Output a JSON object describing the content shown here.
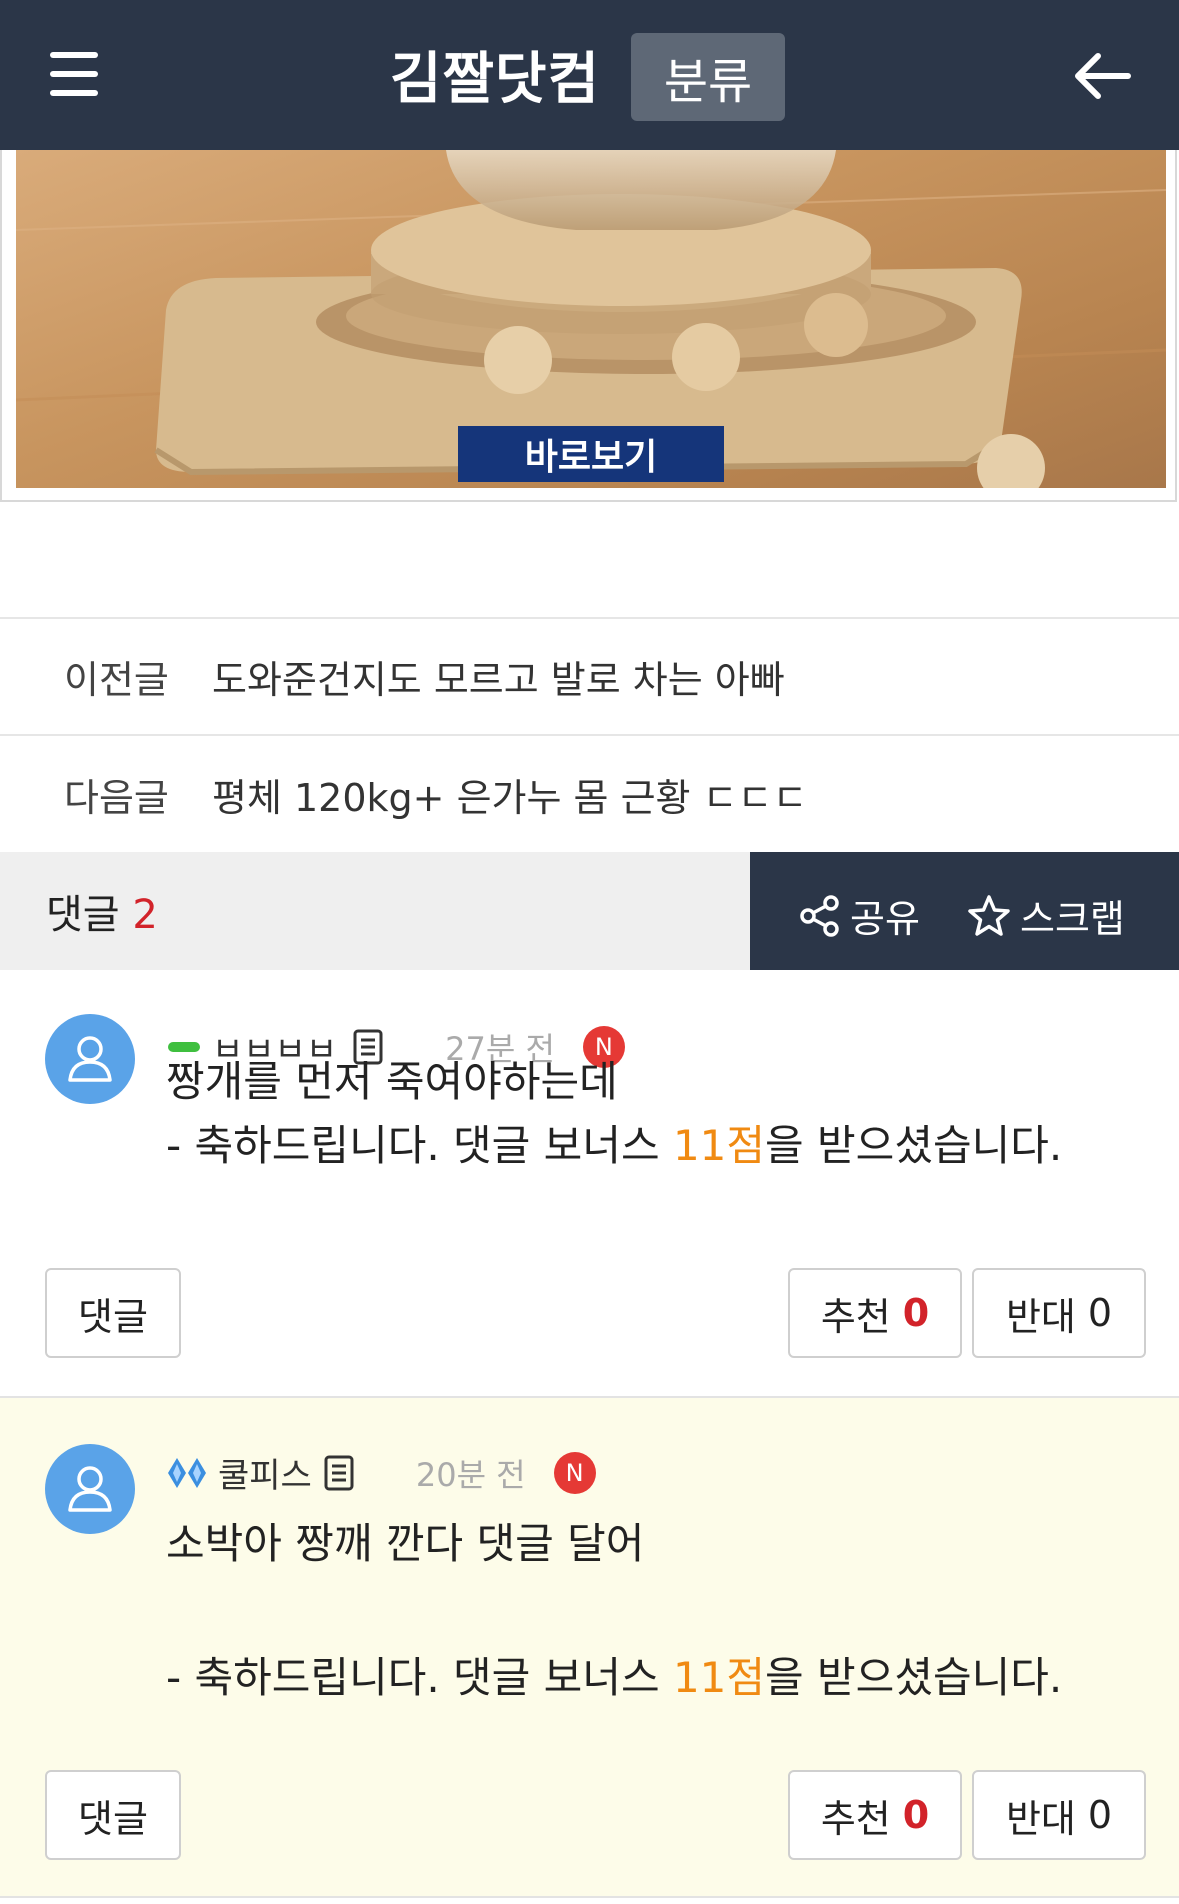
{
  "header": {
    "site_title": "김짤닷컴",
    "category_label": "분류"
  },
  "image": {
    "view_label": "바로보기"
  },
  "nav": {
    "prev_label": "이전글",
    "prev_title": "도와준건지도 모르고 발로 차는 아빠",
    "next_label": "다음글",
    "next_title": "평체 120kg+ 은가누 몸 근황 ㄷㄷㄷ"
  },
  "comment_bar": {
    "label": "댓글",
    "count": "2",
    "share_label": "공유",
    "scrap_label": "스크랩"
  },
  "comments": [
    {
      "nickname": "ㅂㅂㅂㅂ",
      "time": "27분 전",
      "badge": "N",
      "text": "짱개를 먼저 죽여야하는데",
      "bonus_prefix": "- 축하드립니다. 댓글 보너스 ",
      "bonus_points": "11점",
      "bonus_suffix": "을 받으셨습니다.",
      "reply_label": "댓글",
      "up_label": "추천",
      "up_count": "0",
      "down_label": "반대",
      "down_count": "0"
    },
    {
      "nickname": "쿨피스",
      "time": "20분 전",
      "badge": "N",
      "text": "소박아 짱깨 깐다 댓글 달어",
      "bonus_prefix": "- 축하드립니다. 댓글 보너스 ",
      "bonus_points": "11점",
      "bonus_suffix": "을 받으셨습니다.",
      "reply_label": "댓글",
      "up_label": "추천",
      "up_count": "0",
      "down_label": "반대",
      "down_count": "0"
    }
  ],
  "colors": {
    "header_bg": "#2b3648",
    "view_button": "#15357a",
    "badge_red": "#e53935",
    "bonus_orange": "#f08a12",
    "comment2_bg": "#fdfce9"
  },
  "icons": [
    "hamburger-menu-icon",
    "back-arrow-icon",
    "share-icon",
    "star-icon",
    "user-icon",
    "memo-icon",
    "level-bar-icon",
    "diamond-rank-icon"
  ]
}
